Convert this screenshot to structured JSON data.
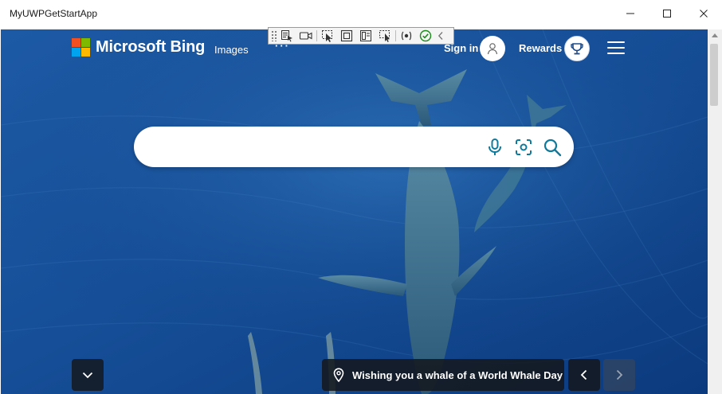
{
  "window": {
    "title": "MyUWPGetStartApp",
    "controls": [
      "minimize-icon",
      "maximize-icon",
      "close-icon"
    ]
  },
  "devtools_toolbar": {
    "icons": [
      "grip-icon",
      "select-element-icon",
      "record-icon",
      "pointer-select-icon",
      "display-layout-icon",
      "track-focus-icon",
      "binding-failures-icon",
      "preview-selection-icon",
      "check-icon",
      "collapse-chevron-icon"
    ]
  },
  "header": {
    "brand": "Microsoft Bing",
    "nav_images": "Images",
    "nav_more": "···",
    "signin": "Sign in",
    "rewards": "Rewards"
  },
  "search": {
    "value": "",
    "placeholder": "",
    "icons": [
      "microphone-icon",
      "visual-search-icon",
      "search-icon"
    ]
  },
  "footer": {
    "caption": "Wishing you a whale of a World Whale Day"
  },
  "colors": {
    "ms_red": "#f25022",
    "ms_green": "#7fba00",
    "ms_blue": "#00a4ef",
    "ms_yellow": "#ffb900",
    "bing_accent": "#0f7a9c",
    "ocean_dark": "#0d3f82",
    "ocean_light": "#2d6fb8"
  }
}
